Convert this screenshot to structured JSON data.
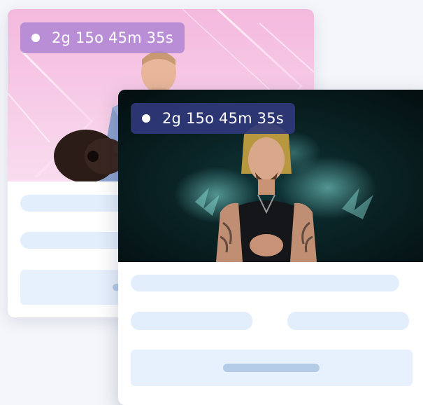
{
  "cards": [
    {
      "id": "back",
      "countdown": "2g 15o 45m 35s",
      "theme": {
        "media_top": "#f2b7dc",
        "media_bottom": "#f7d8ee",
        "badge": "#a880d2"
      }
    },
    {
      "id": "front",
      "countdown": "2g 15o 45m 35s",
      "theme": {
        "media_bg": "#071a1c",
        "badge": "#30387a"
      }
    }
  ],
  "colors": {
    "page_bg": "#f4f6fa",
    "skeleton": "#e3eefc",
    "skeleton_inner": "#b4cce8"
  },
  "icons": {
    "status_dot": "live-dot-icon"
  }
}
